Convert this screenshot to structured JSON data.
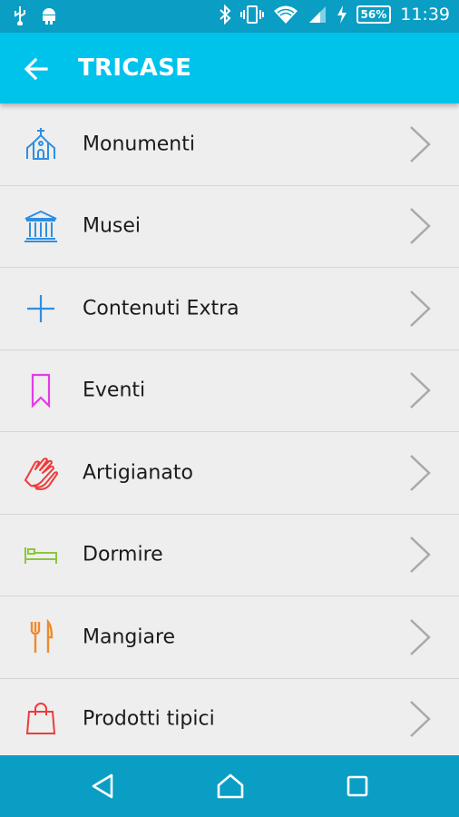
{
  "status_bar": {
    "battery": "56%",
    "time": "11:39",
    "icons": [
      "usb-icon",
      "android-icon",
      "bluetooth-icon",
      "vibrate-icon",
      "wifi-icon",
      "signal-icon",
      "charging-icon",
      "battery-icon"
    ]
  },
  "app_bar": {
    "title": "TRICASE",
    "back_icon": "arrow-back-icon"
  },
  "menu": {
    "items": [
      {
        "label": "Monumenti",
        "icon": "church-icon",
        "color": "#2f8fe0"
      },
      {
        "label": "Musei",
        "icon": "museum-icon",
        "color": "#2f8fe0"
      },
      {
        "label": "Contenuti Extra",
        "icon": "plus-icon",
        "color": "#2f8fe0"
      },
      {
        "label": "Eventi",
        "icon": "bookmark-icon",
        "color": "#e33be6"
      },
      {
        "label": "Artigianato",
        "icon": "hands-icon",
        "color": "#ef3b3b"
      },
      {
        "label": "Dormire",
        "icon": "bed-icon",
        "color": "#8cc63f"
      },
      {
        "label": "Mangiare",
        "icon": "fork-knife-icon",
        "color": "#f08a2c"
      },
      {
        "label": "Prodotti tipici",
        "icon": "shopping-bag-icon",
        "color": "#ef3b3b"
      }
    ]
  },
  "nav_bar": {
    "icons": [
      "back-triangle-icon",
      "home-icon",
      "recents-icon"
    ]
  }
}
